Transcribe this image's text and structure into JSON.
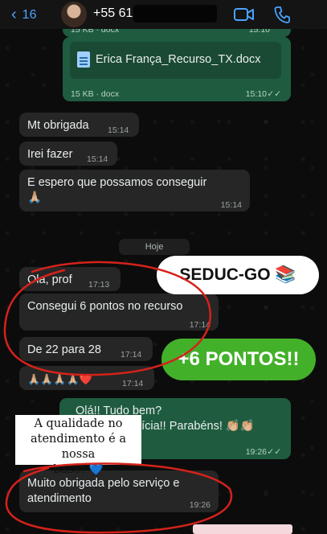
{
  "header": {
    "back_count": "16",
    "contact_name": "+55 61"
  },
  "messages": {
    "top_partial_size": "15 KB · docx",
    "top_partial_time": "15:10",
    "doc_name": "Erica França_Recurso_TX.docx",
    "doc_size": "15 KB · docx",
    "doc_time": "15:10",
    "m1_text": "Mt obrigada",
    "m1_time": "15:14",
    "m2_text": "Irei fazer",
    "m2_time": "15:14",
    "m3_text": "E espero que possamos conseguir",
    "m3_emoji": "🙏🏼",
    "m3_time": "15:14",
    "date_label": "Hoje",
    "m4_text": "Ola, prof",
    "m4_time": "17:13",
    "m5_text": "Consegui 6 pontos no recurso",
    "m5_time": "17:14",
    "m6_text": "De 22 para 28",
    "m6_time": "17:14",
    "m7_text": "🙏🏼🙏🏼🙏🏼🙏🏼❤️",
    "m7_time": "17:14",
    "m8_line1": "Olá!! Tudo bem?",
    "m8_line2": "otícia!! Parabéns! 👏🏼👏🏼",
    "m8_time": "19:26",
    "m9_line1": "Muito obrigada pelo serviço e",
    "m9_line2": "atendimento",
    "m9_time": "19:26"
  },
  "stickers": {
    "seduc": "SEDUC-GO 📚",
    "pontos": "+6 PONTOS!!",
    "quality_line1": "A qualidade no",
    "quality_line2": "atendimento é a nossa",
    "quality_line3": "base! 💙"
  },
  "colors": {
    "accent_blue": "#4aa3ff",
    "incoming_bubble": "#262626",
    "outgoing_bubble": "#1f5c3f",
    "highlight_red": "#d4221b",
    "pontos_green": "#43b02a"
  },
  "icons": {
    "back": "chevron-left-icon",
    "video": "video-camera-icon",
    "call": "phone-icon",
    "doc": "document-icon",
    "read": "double-check-icon"
  }
}
